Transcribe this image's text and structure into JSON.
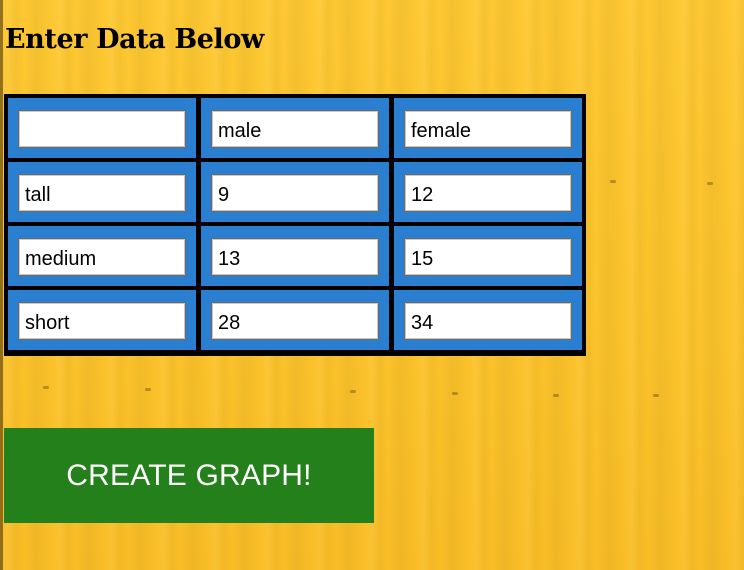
{
  "page": {
    "heading": "Enter Data Below"
  },
  "table": {
    "rows": [
      [
        "",
        "male",
        "female"
      ],
      [
        "tall",
        "9",
        "12"
      ],
      [
        "medium",
        "13",
        "15"
      ],
      [
        "short",
        "28",
        "34"
      ]
    ]
  },
  "actions": {
    "create_graph_label": "CREATE GRAPH!"
  },
  "colors": {
    "background": "#fcc42c",
    "table_border": "#000000",
    "cell": "#2a7fd0",
    "button": "#24801a"
  }
}
